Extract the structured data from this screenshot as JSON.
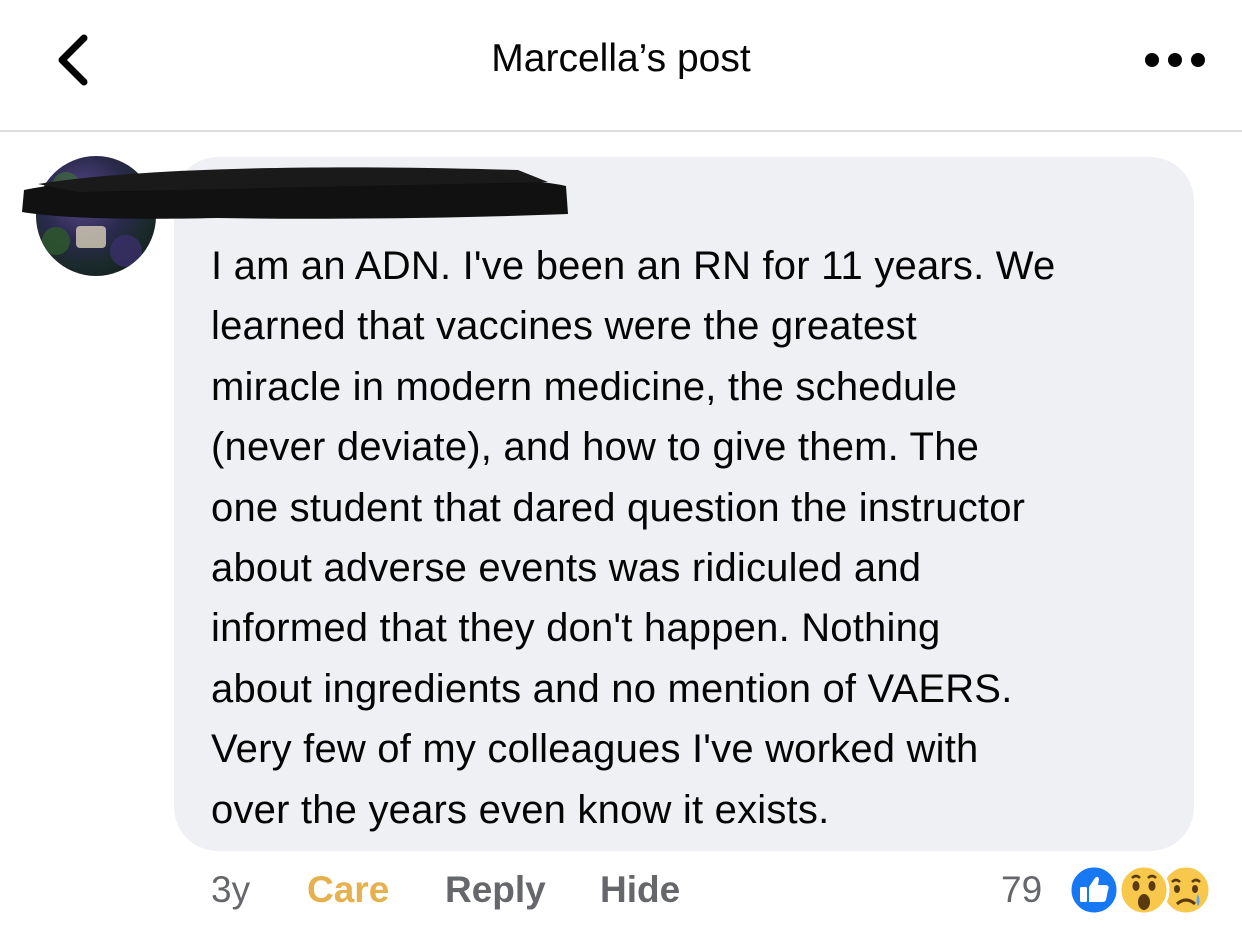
{
  "header": {
    "title": "Marcella’s post",
    "back_icon": "chevron-left-icon",
    "more_icon": "more-horizontal-icon"
  },
  "comment": {
    "author_redacted": true,
    "text": "I am an ADN. I've been an RN for 11 years. We learned that vaccines were the greatest miracle in modern medicine, the schedule (never deviate), and how to give them. The one student that dared question the instructor about adverse events was ridiculed and informed that they don't happen. Nothing about ingredients and no mention of VAERS. Very few of my colleagues I've worked with over the years even know it exists.",
    "lines": [
      "I am an ADN. I've been an RN for 11 years. We",
      "learned that vaccines were the greatest",
      "miracle in modern medicine, the schedule",
      "(never deviate), and how to give them. The",
      "one student that dared question the instructor",
      "about adverse events was ridiculed and",
      "informed that they don't happen. Nothing",
      "about ingredients and no mention of VAERS.",
      "Very few of my colleagues I've worked with",
      "over the years even know it exists."
    ],
    "time": "3y",
    "actions": {
      "care": "Care",
      "reply": "Reply",
      "hide": "Hide"
    },
    "reaction_count": "79",
    "reaction_icons": [
      "like-icon",
      "wow-icon",
      "sad-icon"
    ]
  },
  "colors": {
    "bubble": "#eff0f3",
    "care": "#e6b14c",
    "secondary_text": "#65676b",
    "like_blue": "#1877f2"
  }
}
